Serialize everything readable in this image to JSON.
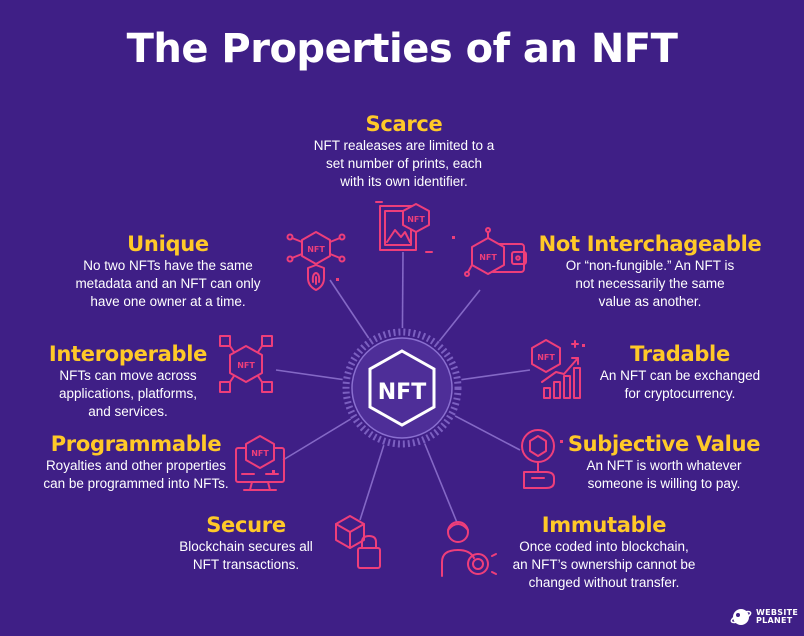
{
  "title": "The Properties of an NFT",
  "center_label": "NFT",
  "icon_label": "NFT",
  "properties": [
    {
      "id": "scarce",
      "heading": "Scarce",
      "desc_lines": [
        "NFT realeases are limited to a",
        "set number of prints, each",
        "with its own identifier."
      ]
    },
    {
      "id": "unique",
      "heading": "Unique",
      "desc_lines": [
        "No two NFTs have the same",
        "metadata and an NFT can only",
        "have one owner at a time."
      ]
    },
    {
      "id": "not-interchangeable",
      "heading": "Not Interchageable",
      "desc_lines": [
        "Or “non-fungible.” An NFT is",
        "not necessarily the same",
        "value as another."
      ]
    },
    {
      "id": "interoperable",
      "heading": "Interoperable",
      "desc_lines": [
        "NFTs can move across",
        "applications, platforms,",
        "and services."
      ]
    },
    {
      "id": "tradable",
      "heading": "Tradable",
      "desc_lines": [
        "An NFT can be exchanged",
        "for cryptocurrency."
      ]
    },
    {
      "id": "programmable",
      "heading": "Programmable",
      "desc_lines": [
        "Royalties and other properties",
        "can be programmed into NFTs."
      ]
    },
    {
      "id": "subjective-value",
      "heading": "Subjective Value",
      "desc_lines": [
        "An NFT is worth whatever",
        "someone is willing to pay."
      ]
    },
    {
      "id": "secure",
      "heading": "Secure",
      "desc_lines": [
        "Blockchain secures all",
        "NFT transactions."
      ]
    },
    {
      "id": "immutable",
      "heading": "Immutable",
      "desc_lines": [
        "Once coded into blockchain,",
        "an NFT’s ownership cannot be",
        "changed without transfer."
      ]
    }
  ],
  "brand": {
    "line1": "WEBSITE",
    "line2": "PLANET"
  },
  "colors": {
    "background": "#3f1f86",
    "heading": "#ffc928",
    "icon": "#ee3e7a",
    "hub": "#4e2e98",
    "spoke": "#8468c6"
  }
}
